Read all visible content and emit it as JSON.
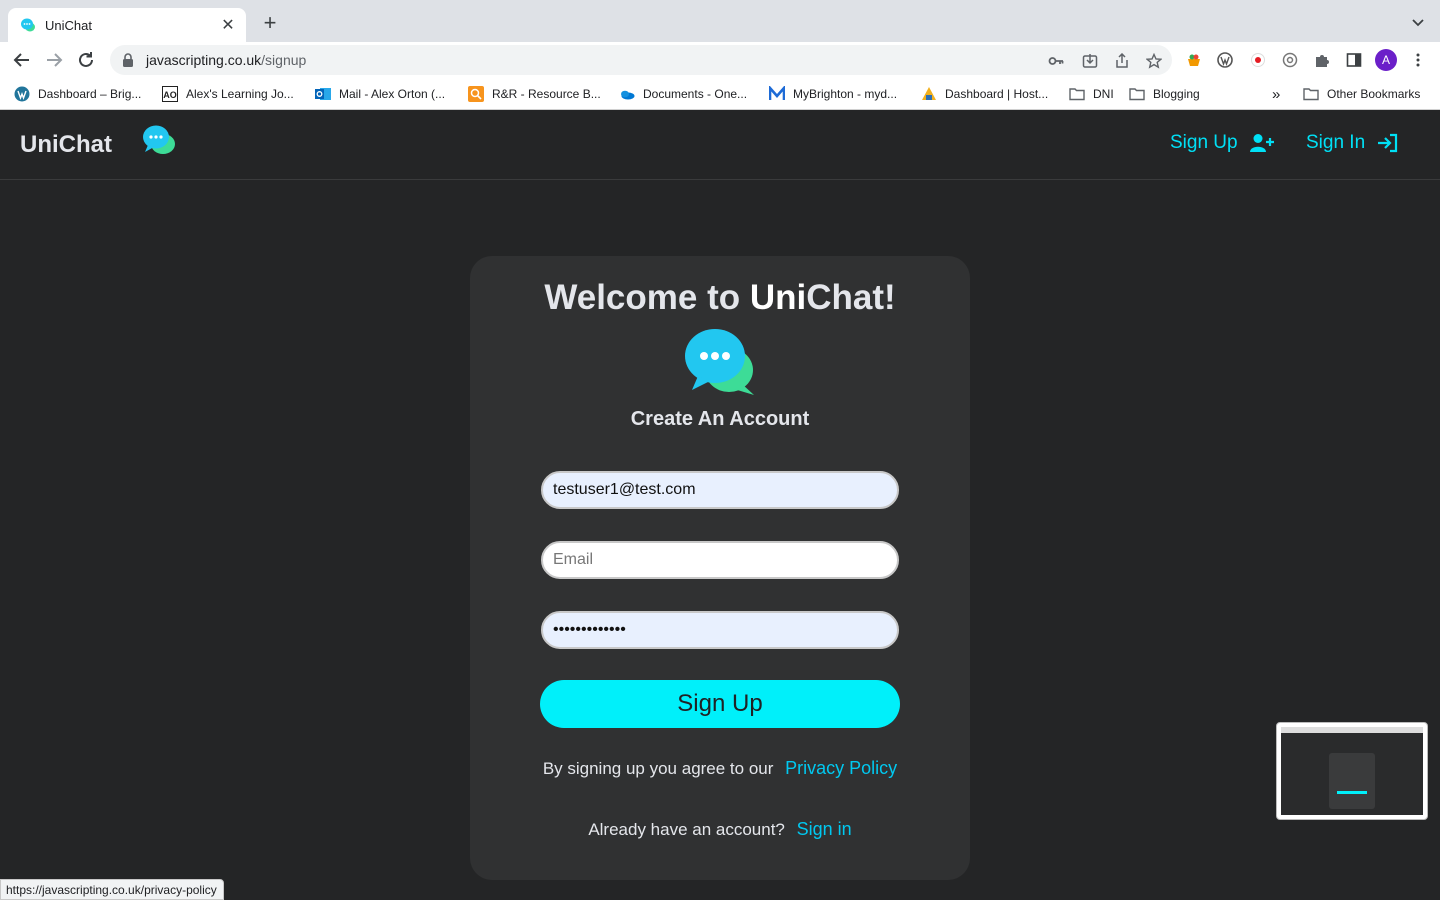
{
  "browser": {
    "tab": {
      "title": "UniChat",
      "close": "✕"
    },
    "new_tab": "+",
    "url": {
      "host": "javascripting.co.uk",
      "path": "/signup"
    },
    "avatar_letter": "A",
    "bookmarks": [
      {
        "label": "Dashboard – Brig...",
        "icon": "wordpress-icon"
      },
      {
        "label": "Alex's Learning Jo...",
        "icon": "ao-icon"
      },
      {
        "label": "Mail - Alex Orton (...",
        "icon": "outlook-icon"
      },
      {
        "label": "R&R - Resource B...",
        "icon": "search-orange-icon"
      },
      {
        "label": "Documents - One...",
        "icon": "onedrive-icon"
      },
      {
        "label": "MyBrighton - myd...",
        "icon": "m-icon"
      },
      {
        "label": "Dashboard | Host...",
        "icon": "host-icon"
      },
      {
        "label": "DNI",
        "icon": "folder-icon"
      },
      {
        "label": "Blogging",
        "icon": "folder-icon"
      }
    ],
    "bookmarks_overflow": "»",
    "other_bookmarks": "Other Bookmarks",
    "status_url": "https://javascripting.co.uk/privacy-policy"
  },
  "nav": {
    "brand": "UniChat",
    "signup_label": "Sign Up",
    "signin_label": "Sign In"
  },
  "form": {
    "welcome_prefix": "Welcome to ",
    "welcome_bold": "Uni",
    "welcome_suffix": "Chat!",
    "subtitle": "Create An Account",
    "username_value": "testuser1@test.com",
    "email_placeholder": "Email",
    "password_value": "•••••••••••••",
    "submit_label": "Sign Up",
    "agree_text": "By signing up you agree to our",
    "privacy_link": "Privacy Policy",
    "already_text": "Already have an account?",
    "signin_link": "Sign in"
  },
  "colors": {
    "accent": "#00f0fa",
    "link": "#00c8f0",
    "background": "#242526",
    "card": "#303132"
  }
}
